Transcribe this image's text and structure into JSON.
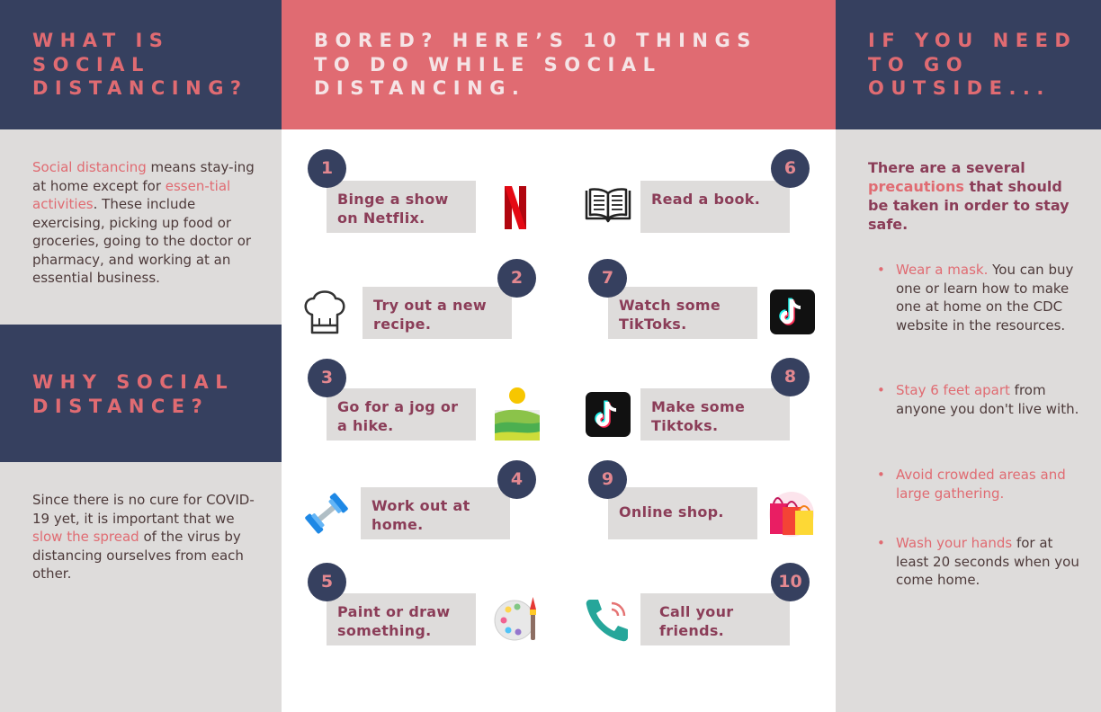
{
  "left": {
    "header1": "WHAT IS\nSOCIAL\nDISTANCING?",
    "p1": {
      "hl1": "Social distancing",
      "t1": " means stay-ing at home except for ",
      "hl2": "essen-tial activities",
      "t2": ". These include exercising, picking up food or groceries, going to the doctor or pharmacy,  and working at an essential business."
    },
    "header2": "WHY SOCIAL\nDISTANCE?",
    "p2": {
      "t1": "Since there is no cure for COVID-19 yet, it is important that we ",
      "hl1": "slow the spread",
      "t2": " of the virus by distancing ourselves from each other."
    }
  },
  "middle": {
    "header": "BORED? HERE’S 10 THINGS\nTO DO WHILE SOCIAL\nDISTANCING.",
    "items": [
      {
        "num": "1",
        "label": "Binge a show on Netflix.",
        "icon": "netflix-logo-icon"
      },
      {
        "num": "2",
        "label": "Try out a new recipe.",
        "icon": "chef-hat-icon"
      },
      {
        "num": "3",
        "label": "Go for a jog or a hike.",
        "icon": "landscape-icon"
      },
      {
        "num": "4",
        "label": "Work out at home.",
        "icon": "dumbbell-icon"
      },
      {
        "num": "5",
        "label": "Paint or draw something.",
        "icon": "palette-icon"
      },
      {
        "num": "6",
        "label": "Read a book.",
        "icon": "open-book-icon"
      },
      {
        "num": "7",
        "label": "Watch some TikToks.",
        "icon": "tiktok-icon"
      },
      {
        "num": "8",
        "label": "Make some Tiktoks.",
        "icon": "tiktok-icon"
      },
      {
        "num": "9",
        "label": "Online shop.",
        "icon": "shopping-bags-icon"
      },
      {
        "num": "10",
        "label": "Call your friends.",
        "icon": "phone-icon"
      }
    ]
  },
  "right": {
    "header": "IF YOU NEED\nTO GO\nOUTSIDE...",
    "intro": {
      "t1": "There are a several ",
      "hl1": "precautions",
      "t2": " that should be taken in order to stay safe."
    },
    "precautions": [
      {
        "hl": "Wear a mask.",
        "text": " You can buy one or learn how to make one at home on the CDC website in the resources."
      },
      {
        "hl": "Stay 6 feet apart",
        "text": " from anyone you don't live with."
      },
      {
        "hl": "Avoid crowded areas and large gathering.",
        "text": ""
      },
      {
        "hl": "Wash your hands",
        "text": " for at least 20 seconds when you come home."
      }
    ],
    "bullet": "•"
  },
  "colors": {
    "navy": "#36405f",
    "pink": "#e06b72",
    "light_gray": "#dedcdb",
    "maroon_text": "#8b3d58"
  }
}
